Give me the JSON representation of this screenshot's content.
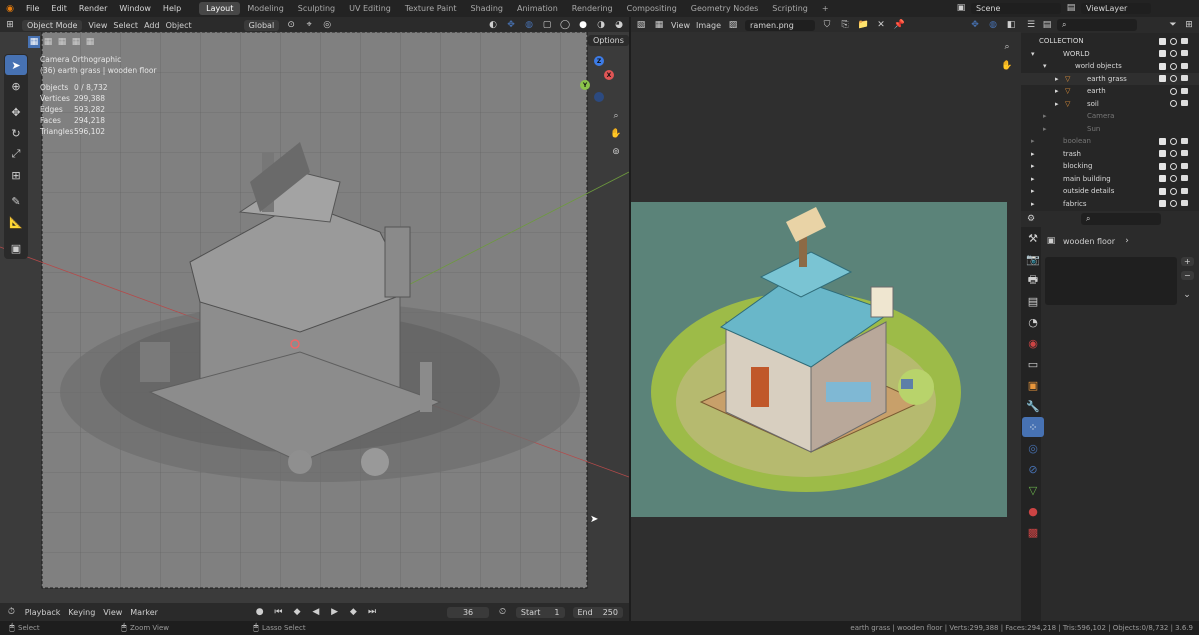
{
  "menu": [
    "File",
    "Edit",
    "Render",
    "Window",
    "Help"
  ],
  "workspaces": [
    "Layout",
    "Modeling",
    "Sculpting",
    "UV Editing",
    "Texture Paint",
    "Shading",
    "Animation",
    "Rendering",
    "Compositing",
    "Geometry Nodes",
    "Scripting",
    "+"
  ],
  "active_workspace": "Layout",
  "scene": {
    "label": "Scene"
  },
  "view_layer": {
    "label": "ViewLayer"
  },
  "viewport_header": {
    "mode": "Object Mode",
    "menus": [
      "View",
      "Select",
      "Add",
      "Object"
    ],
    "orientation": "Global",
    "options": "Options"
  },
  "viewport_info": {
    "camera": "Camera Orthographic",
    "context": "(36) earth grass | wooden floor",
    "stats": [
      {
        "k": "Objects",
        "v": "0 / 8,732"
      },
      {
        "k": "Vertices",
        "v": "299,388"
      },
      {
        "k": "Edges",
        "v": "593,282"
      },
      {
        "k": "Faces",
        "v": "294,218"
      },
      {
        "k": "Triangles",
        "v": "596,102"
      }
    ]
  },
  "gizmo": {
    "x": "X",
    "y": "Y",
    "z": "Z"
  },
  "image_editor": {
    "menus": [
      "View",
      "Image"
    ],
    "image_name": "ramen.png"
  },
  "outliner": {
    "rows": [
      {
        "name": "COLLECTION",
        "indent": 0,
        "arrow": ""
      },
      {
        "name": "WORLD",
        "indent": 0,
        "arrow": "▾"
      },
      {
        "name": "world objects",
        "indent": 1,
        "arrow": "▾"
      },
      {
        "name": "earth grass",
        "indent": 2,
        "arrow": "▸"
      },
      {
        "name": "earth",
        "indent": 2,
        "arrow": "▸"
      },
      {
        "name": "soil",
        "indent": 2,
        "arrow": "▸"
      },
      {
        "name": "Camera",
        "indent": 1,
        "arrow": "▸"
      },
      {
        "name": "Sun",
        "indent": 1,
        "arrow": "▸"
      },
      {
        "name": "boolean",
        "indent": 0,
        "arrow": "▸"
      },
      {
        "name": "trash",
        "indent": 0,
        "arrow": "▸"
      },
      {
        "name": "blocking",
        "indent": 0,
        "arrow": "▸"
      },
      {
        "name": "main building",
        "indent": 0,
        "arrow": "▸"
      },
      {
        "name": "outside details",
        "indent": 0,
        "arrow": "▸"
      },
      {
        "name": "fabrics",
        "indent": 0,
        "arrow": "▸"
      }
    ]
  },
  "properties": {
    "breadcrumb": "wooden floor"
  },
  "timeline": {
    "menus": [
      "Playback",
      "Keying",
      "View",
      "Marker"
    ],
    "current_frame": "36",
    "start_label": "Start",
    "start": "1",
    "end_label": "End",
    "end": "250"
  },
  "status": {
    "left": [
      "Select",
      "Zoom View",
      "Lasso Select"
    ],
    "right": "earth grass | wooden floor | Verts:299,388 | Faces:294,218 | Tris:596,102 | Objects:0/8,732 | 3.6.9"
  },
  "colors": {
    "accent": "#4772b3",
    "bg": "#1d1d1d",
    "viewport": "#3e3e3e",
    "render_bg": "#5b8379"
  }
}
